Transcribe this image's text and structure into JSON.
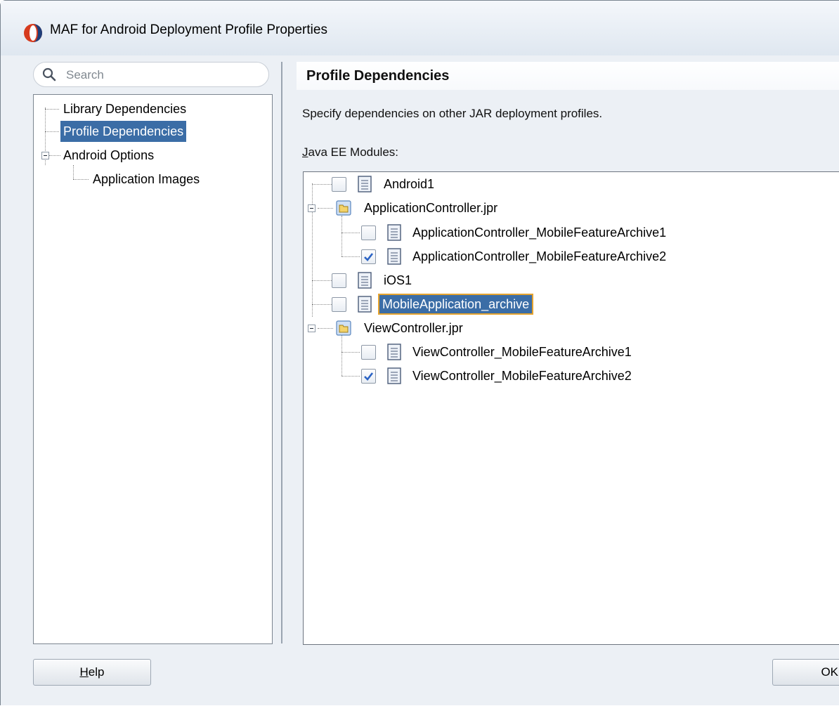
{
  "window": {
    "title": "MAF for Android Deployment Profile Properties"
  },
  "search": {
    "placeholder": "Search"
  },
  "nav": {
    "items": [
      {
        "label": "Library Dependencies"
      },
      {
        "label": "Profile Dependencies",
        "selected": true
      },
      {
        "label": "Android Options",
        "expanded": true
      },
      {
        "label": "Application Images"
      }
    ]
  },
  "page": {
    "header": "Profile Dependencies",
    "description": "Specify dependencies on other JAR deployment profiles.",
    "modules_label_mnemonic": "J",
    "modules_label_rest": "ava EE Modules:"
  },
  "modules": [
    {
      "label": "Android1",
      "type": "document",
      "checked": false
    },
    {
      "label": "ApplicationController.jpr",
      "type": "project",
      "expanded": true
    },
    {
      "label": "ApplicationController_MobileFeatureArchive1",
      "type": "document",
      "checked": false
    },
    {
      "label": "ApplicationController_MobileFeatureArchive2",
      "type": "document",
      "checked": true
    },
    {
      "label": "iOS1",
      "type": "document",
      "checked": false
    },
    {
      "label": "MobileApplication_archive",
      "type": "document",
      "checked": false,
      "selected": true
    },
    {
      "label": "ViewController.jpr",
      "type": "project",
      "expanded": true
    },
    {
      "label": "ViewController_MobileFeatureArchive1",
      "type": "document",
      "checked": false
    },
    {
      "label": "ViewController_MobileFeatureArchive2",
      "type": "document",
      "checked": true
    }
  ],
  "buttons": {
    "help_mnemonic": "H",
    "help_rest": "elp",
    "ok": "OK"
  },
  "colors": {
    "selection": "#3b6da6",
    "focus_border": "#e5a32e",
    "window_bg": "#ecf0f5"
  }
}
